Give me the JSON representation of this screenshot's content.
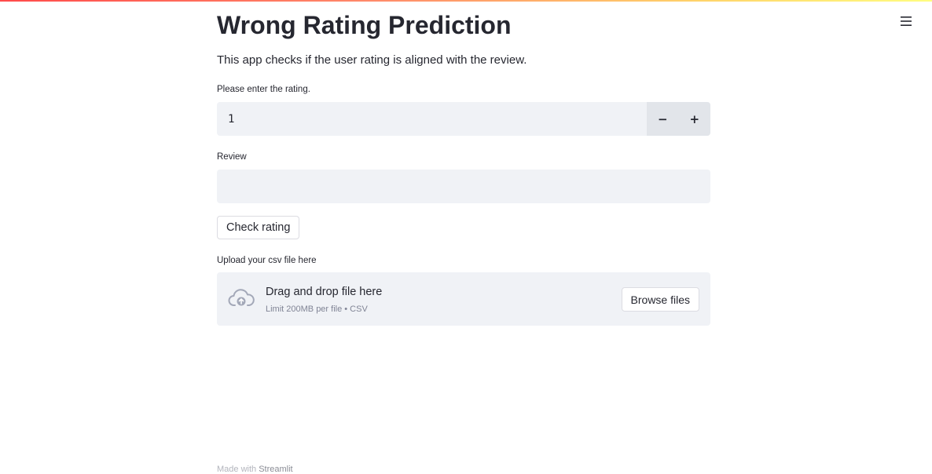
{
  "header": {
    "menu_icon": "hamburger-icon"
  },
  "main": {
    "title": "Wrong Rating Prediction",
    "subtitle": "This app checks if the user rating is aligned with the review."
  },
  "rating_input": {
    "label": "Please enter the rating.",
    "value": "1",
    "decrement_label": "−",
    "increment_label": "+"
  },
  "review_input": {
    "label": "Review",
    "value": ""
  },
  "check_button": {
    "label": "Check rating"
  },
  "file_uploader": {
    "label": "Upload your csv file here",
    "icon": "cloud-upload-icon",
    "drop_text": "Drag and drop file here",
    "limit_text": "Limit 200MB per file • CSV",
    "browse_label": "Browse files"
  },
  "footer": {
    "prefix": "Made with ",
    "brand": "Streamlit"
  },
  "colors": {
    "widget_background": "#f0f2f6",
    "text": "#262730",
    "accent": "#ff4b4b"
  }
}
